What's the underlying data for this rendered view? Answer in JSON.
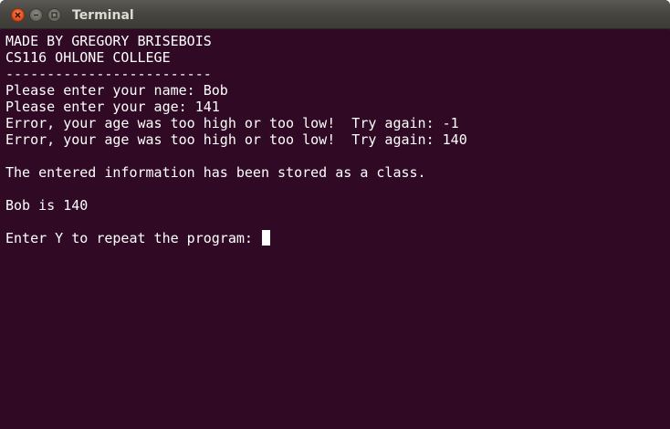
{
  "window": {
    "title": "Terminal"
  },
  "terminal": {
    "lines": [
      "MADE BY GREGORY BRISEBOIS",
      "CS116 OHLONE COLLEGE",
      "-------------------------",
      "Please enter your name: Bob",
      "Please enter your age: 141",
      "Error, your age was too high or too low!  Try again: -1",
      "Error, your age was too high or too low!  Try again: 140",
      "",
      "The entered information has been stored as a class.",
      "",
      "Bob is 140",
      "",
      "Enter Y to repeat the program: "
    ]
  },
  "colors": {
    "background": "#300a24",
    "foreground": "#ffffff",
    "titlebar": "#46453f",
    "close_button": "#e3501d"
  }
}
